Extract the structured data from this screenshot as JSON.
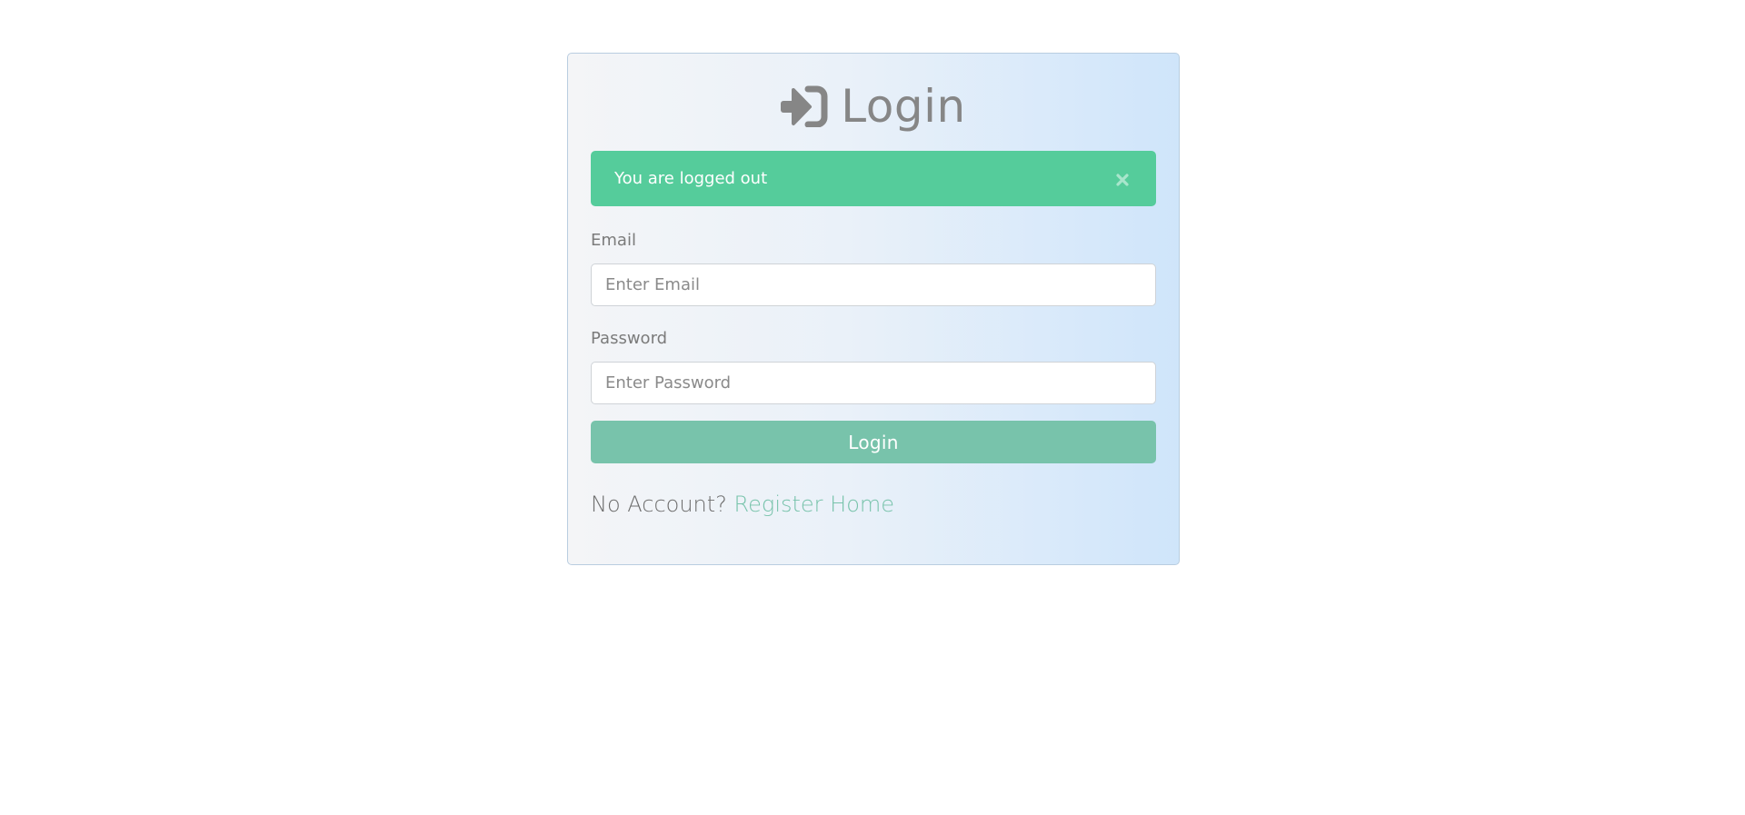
{
  "login_card": {
    "title": "Login",
    "title_icon": "sign-in-icon",
    "alert": {
      "message": "You are logged out",
      "close_icon": "close-icon",
      "color": "#55cc9b"
    },
    "email": {
      "label": "Email",
      "placeholder": "Enter Email",
      "value": ""
    },
    "password": {
      "label": "Password",
      "placeholder": "Enter Password",
      "value": ""
    },
    "submit_label": "Login",
    "submit_color": "#78c3ab",
    "footer": {
      "prompt": "No Account?",
      "register_link": "Register",
      "home_link": "Home"
    }
  }
}
